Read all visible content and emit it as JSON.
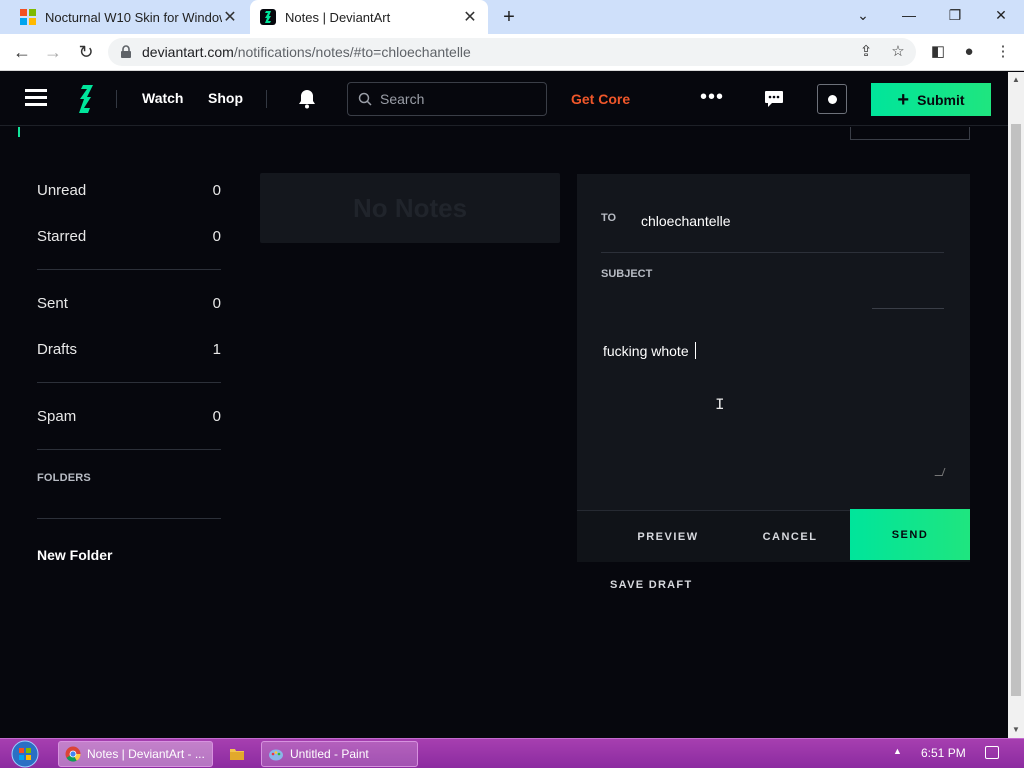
{
  "browser": {
    "tabs": [
      {
        "title": "Nocturnal W10 Skin for Window",
        "active": false
      },
      {
        "title": "Notes | DeviantArt",
        "active": true
      }
    ],
    "new_tab": "+",
    "window_controls": {
      "dropdown": "⌄",
      "minimize": "—",
      "restore": "❐",
      "close": "✕"
    },
    "url_host": "deviantart.com",
    "url_path": "/notifications/notes/#to=chloechantelle"
  },
  "header": {
    "watch": "Watch",
    "shop": "Shop",
    "search_placeholder": "Search",
    "get_core": "Get Core",
    "more": "•••",
    "submit": "Submit",
    "submit_plus": "+"
  },
  "sidebar": {
    "group1": [
      {
        "label": "Unread",
        "count": "0"
      },
      {
        "label": "Starred",
        "count": "0"
      }
    ],
    "group2": [
      {
        "label": "Sent",
        "count": "0"
      },
      {
        "label": "Drafts",
        "count": "1"
      }
    ],
    "group3": [
      {
        "label": "Spam",
        "count": "0"
      }
    ],
    "folders_label": "FOLDERS",
    "new_folder": "New Folder"
  },
  "notes_list": {
    "empty_text": "No Notes"
  },
  "compose": {
    "to_label": "TO",
    "to_value": "chloechantelle",
    "subject_label": "SUBJECT",
    "subject_value": "",
    "body": "fucking whote",
    "preview": "PREVIEW",
    "cancel": "CANCEL",
    "send": "SEND",
    "save_draft": "SAVE DRAFT"
  },
  "taskbar": {
    "chrome_task": "Notes | DeviantArt - ...",
    "paint_task": "Untitled - Paint",
    "clock": "6:51 PM"
  },
  "colors": {
    "accent": "#00e59b",
    "get_core": "#f0572a",
    "taskbar": "#9b35aa",
    "page_bg": "#06070d"
  }
}
